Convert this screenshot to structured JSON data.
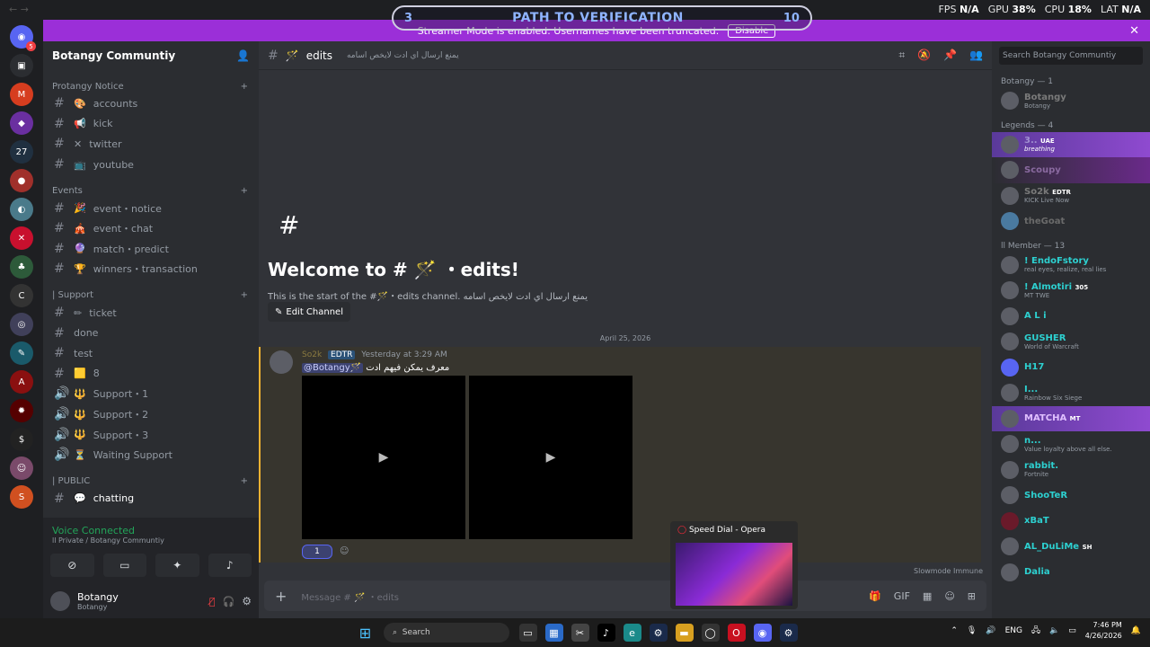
{
  "overlay": {
    "nav_arrows": "← →",
    "path_left": "3",
    "path_title": "PATH TO VERIFICATION",
    "path_right": "10",
    "stats": [
      {
        "label": "FPS",
        "value": "N/A"
      },
      {
        "label": "GPU",
        "value": "38%"
      },
      {
        "label": "CPU",
        "value": "18%"
      },
      {
        "label": "LAT",
        "value": "N/A"
      }
    ]
  },
  "banner": {
    "text": "Streamer Mode is enabled. Usernames have been truncated.",
    "button": "Disable",
    "close": "✕"
  },
  "server": {
    "name": "Botangy Communtiy",
    "chevron": "⌄"
  },
  "sidebar": {
    "categories": [
      {
        "name": "Protangy Notice",
        "channels": [
          {
            "label": "accounts",
            "emoji": "🎨"
          },
          {
            "label": "kick",
            "emoji": "📢"
          },
          {
            "label": "twitter",
            "emoji": "✕"
          },
          {
            "label": "youtube",
            "emoji": "📺"
          }
        ]
      },
      {
        "name": "Events",
        "channels": [
          {
            "label": "event・notice",
            "emoji": "🎉"
          },
          {
            "label": "event・chat",
            "emoji": "🎪"
          },
          {
            "label": "match・predict",
            "emoji": "🔮"
          },
          {
            "label": "winners・transaction",
            "emoji": "🏆"
          }
        ]
      },
      {
        "name": "| Support",
        "channels": [
          {
            "label": "ticket",
            "emoji": "✏"
          },
          {
            "label": "done",
            "emoji": ""
          },
          {
            "label": "test",
            "emoji": ""
          },
          {
            "label": "8",
            "emoji": "🟨"
          },
          {
            "label": "Support・1",
            "emoji": "🔱"
          },
          {
            "label": "Support・2",
            "emoji": "🔱"
          },
          {
            "label": "Support・3",
            "emoji": "🔱"
          },
          {
            "label": "Waiting Support",
            "emoji": "⏳"
          }
        ]
      },
      {
        "name": "| PUBLIC",
        "channels": [
          {
            "label": "chatting",
            "emoji": "💬"
          }
        ]
      }
    ],
    "voice": {
      "status": "Voice Connected",
      "location": "ll Private / Botangy Communtiy"
    },
    "user": {
      "name": "Botangy",
      "status": "Botangy"
    }
  },
  "channel": {
    "name": "edits",
    "emoji": "🪄",
    "topic": "يمنع ارسال اي ادت لايخص اسامه",
    "header_icons": [
      "threads-icon",
      "mute-icon",
      "pin-icon",
      "members-icon"
    ]
  },
  "welcome": {
    "title": "Welcome to # 🪄 ・edits!",
    "subtitle": "This is the start of the #🪄・edits channel. يمنع ارسال اي ادت لايخص اسامه",
    "edit_button": "Edit Channel"
  },
  "date_sep": "April 25, 2026",
  "message": {
    "author": "So2k",
    "tag": "EDTR",
    "time": "Yesterday at 3:29 AM",
    "mention": "@Botangy🪄",
    "text": "معرف يمكن فيهم ادت",
    "reaction_count": "1"
  },
  "composer": {
    "placeholder": "Message # 🪄 ・edits",
    "slowmode": "Slowmode Immune"
  },
  "popup": {
    "title": "Speed Dial - Opera"
  },
  "members": {
    "search_placeholder": "Search Botangy Communtiy",
    "groups": [
      {
        "header": "Botangy — 1",
        "items": [
          {
            "name": "Botangy",
            "sub": "Botangy"
          }
        ]
      },
      {
        "header": "Legends — 4",
        "items": [
          {
            "name": "3..",
            "sub": "breathing",
            "badge": "UAE"
          },
          {
            "name": "Scoupy",
            "sub": ""
          },
          {
            "name": "So2k",
            "sub": "KICK Live Now",
            "badge": "EDTR"
          },
          {
            "name": "theGoat",
            "sub": ""
          }
        ]
      },
      {
        "header": "ll Member — 13",
        "items": [
          {
            "name": "! EndoFstory",
            "sub": "real eyes, realize, real lies"
          },
          {
            "name": "! Almotiri",
            "sub": "MT TWE",
            "badge": "305"
          },
          {
            "name": "A L i",
            "sub": ""
          },
          {
            "name": "GUSHER",
            "sub": "World of Warcraft"
          },
          {
            "name": "H17",
            "sub": ""
          },
          {
            "name": "I...",
            "sub": "Rainbow Six Siege"
          },
          {
            "name": "MATCHA",
            "sub": "",
            "badge": "MT"
          },
          {
            "name": "n...",
            "sub": "Value loyalty above all else."
          },
          {
            "name": "rabbit.",
            "sub": "Fortnite"
          },
          {
            "name": "ShooTeR",
            "sub": ""
          },
          {
            "name": "xBaT",
            "sub": ""
          },
          {
            "name": "AL_DuLiMe",
            "sub": "",
            "badge": "SH"
          },
          {
            "name": "Dalia",
            "sub": ""
          }
        ]
      }
    ]
  },
  "taskbar": {
    "search": "Search",
    "lang": "ENG",
    "time": "7:46 PM",
    "date": "4/26/2026"
  }
}
